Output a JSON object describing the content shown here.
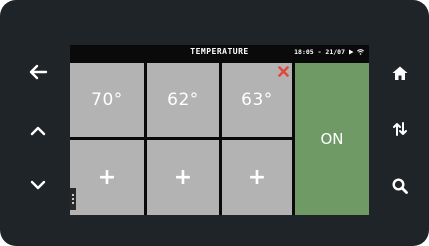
{
  "status_bar": {
    "title": "TEMPERATURE",
    "datetime": "18:05 - 21/07"
  },
  "tiles": [
    {
      "label": "70°"
    },
    {
      "label": "62°"
    },
    {
      "label": "63°"
    },
    {
      "label": "+"
    },
    {
      "label": "+"
    },
    {
      "label": "+"
    }
  ],
  "power_button": {
    "label": "ON",
    "color": "#6f9a66"
  },
  "colors": {
    "device": "#1f2428",
    "tile": "#b3b3b3",
    "close_mark": "#e0483f"
  },
  "left_controls": [
    "back-arrow-icon",
    "chevron-up-icon",
    "chevron-down-icon"
  ],
  "right_controls": [
    "home-icon",
    "sort-arrows-icon",
    "search-icon"
  ]
}
